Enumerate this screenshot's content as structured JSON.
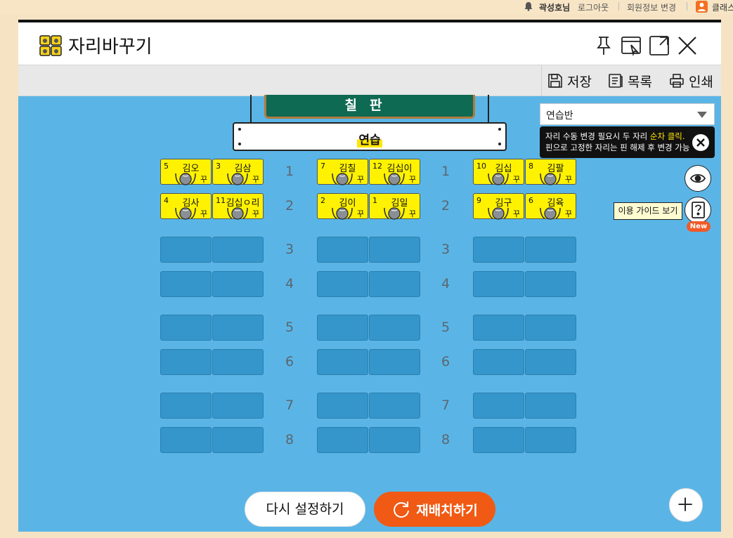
{
  "topbar": {
    "user_name": "곽성호님",
    "logout": "로그아웃",
    "profile_edit": "회원정보 변경",
    "class_link": "클래스"
  },
  "window": {
    "title": "자리바꾸기",
    "toolbar": {
      "save": "저장",
      "list": "목록",
      "print": "인쇄"
    }
  },
  "classroom": {
    "blackboard": "칠판",
    "teacher_desk": "연습",
    "class_select": "연습반",
    "tooltip": {
      "line1_prefix": "자리 수동 변경 필요시 두 자리 ",
      "line1_highlight": "순차 클릭.",
      "line2": "핀으로 고정한 자리는 핀 해제 후 변경 가능"
    },
    "guide_label": "이용 가이드 보기",
    "new_badge": "New",
    "reset_button": "다시 설정하기",
    "shuffle_button": "재배치하기",
    "row_numbers": [
      "1",
      "2",
      "3",
      "4",
      "5",
      "6",
      "7",
      "8"
    ],
    "tag": "꾸",
    "seats": [
      {
        "num": "5",
        "name": "김오"
      },
      {
        "num": "3",
        "name": "김삼"
      },
      {
        "num": "7",
        "name": "김칠"
      },
      {
        "num": "12",
        "name": "김십이"
      },
      {
        "num": "10",
        "name": "김십"
      },
      {
        "num": "8",
        "name": "김팔"
      },
      {
        "num": "4",
        "name": "김사"
      },
      {
        "num": "11",
        "name": "김십ㅇ리"
      },
      {
        "num": "2",
        "name": "김이"
      },
      {
        "num": "1",
        "name": "김일"
      },
      {
        "num": "9",
        "name": "김구"
      },
      {
        "num": "6",
        "name": "김육"
      }
    ]
  }
}
